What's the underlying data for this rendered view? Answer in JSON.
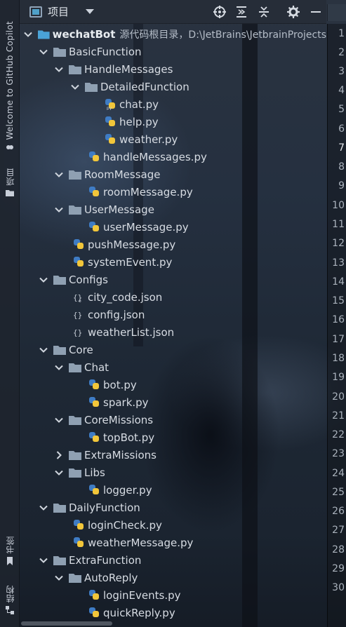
{
  "left_strip": {
    "copilot": "Welcome to GitHub Copilot",
    "project": "项目",
    "bookmarks": "书签",
    "structure": "结构"
  },
  "header": {
    "title": "项目",
    "icons": [
      "crosshair-icon",
      "expand-all-icon",
      "collapse-all-icon",
      "gear-icon",
      "minimize-icon"
    ]
  },
  "tree": {
    "root_name": "wechatBot",
    "root_hint": "源代码根目录，D:\\JetBrains\\JetbrainProjects",
    "items": {
      "basic": "BasicFunction",
      "handle_messages": "HandleMessages",
      "detailed_function": "DetailedFunction",
      "chat_py": "chat.py",
      "help_py": "help.py",
      "weather_py": "weather.py",
      "handle_messages_py": "handleMessages.py",
      "room_message": "RoomMessage",
      "room_message_py": "roomMessage.py",
      "user_message": "UserMessage",
      "user_message_py": "userMessage.py",
      "push_message_py": "pushMessage.py",
      "system_event_py": "systemEvent.py",
      "configs": "Configs",
      "city_code_json": "city_code.json",
      "config_json": "config.json",
      "weather_list_json": "weatherList.json",
      "core": "Core",
      "chat": "Chat",
      "bot_py": "bot.py",
      "spark_py": "spark.py",
      "core_missions": "CoreMissions",
      "top_bot_py": "topBot.py",
      "extra_missions": "ExtraMissions",
      "libs": "Libs",
      "logger_py": "logger.py",
      "daily_function": "DailyFunction",
      "login_check_py": "loginCheck.py",
      "weather_message_py": "weatherMessage.py",
      "extra_function": "ExtraFunction",
      "auto_reply": "AutoReply",
      "login_events_py": "loginEvents.py",
      "quick_reply_py": "quickReply.py"
    }
  },
  "gutter": {
    "lines": [
      "1",
      "2",
      "3",
      "4",
      "5",
      "6",
      "7",
      "8",
      "9",
      "10",
      "11",
      "12",
      "13",
      "14",
      "15",
      "16",
      "17",
      "18",
      "19",
      "20",
      "21",
      "22",
      "23",
      "24",
      "25",
      "26",
      "27",
      "28",
      "29",
      "30"
    ]
  },
  "colors": {
    "folder": "#8fa0b2",
    "root_folder": "#4aa3d8",
    "python_blue": "#3f7cc4",
    "python_yellow": "#f2c63a"
  }
}
